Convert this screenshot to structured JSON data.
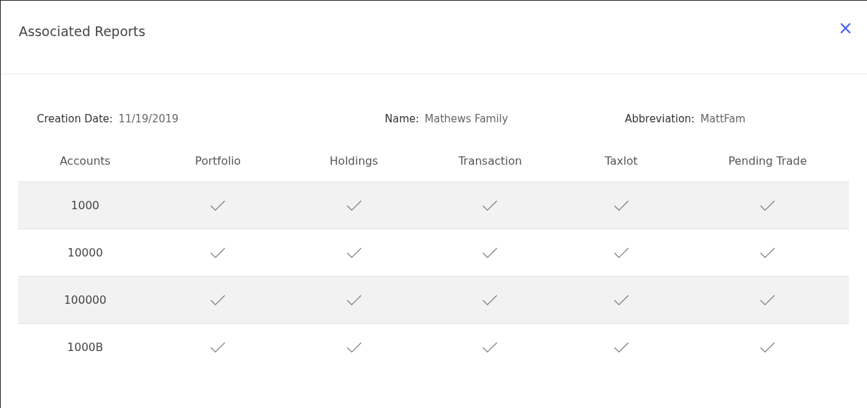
{
  "dialog": {
    "title": "Associated Reports",
    "close": "×"
  },
  "info": [
    {
      "label": "Creation Date:",
      "value": "11/19/2019"
    },
    {
      "label": "Name:",
      "value": "Mathews Family"
    },
    {
      "label": "Abbreviation:",
      "value": "MattFam"
    }
  ],
  "table": {
    "columns": [
      "Accounts",
      "Portfolio",
      "Holdings",
      "Transaction",
      "Taxlot",
      "Pending Trade"
    ],
    "rows": [
      {
        "account": "1000",
        "reports": [
          {
            "checked": true
          },
          {
            "checked": true
          },
          {
            "checked": true
          },
          {
            "checked": true
          },
          {
            "checked": true
          }
        ]
      },
      {
        "account": "10000",
        "reports": [
          {
            "checked": true
          },
          {
            "checked": true
          },
          {
            "checked": true
          },
          {
            "checked": true
          },
          {
            "checked": true
          }
        ]
      },
      {
        "account": "100000",
        "reports": [
          {
            "checked": true
          },
          {
            "checked": true
          },
          {
            "checked": true
          },
          {
            "checked": true
          },
          {
            "checked": true
          }
        ]
      },
      {
        "account": "1000B",
        "reports": [
          {
            "checked": true
          },
          {
            "checked": true
          },
          {
            "checked": true
          },
          {
            "checked": true
          },
          {
            "checked": true
          }
        ]
      }
    ]
  }
}
